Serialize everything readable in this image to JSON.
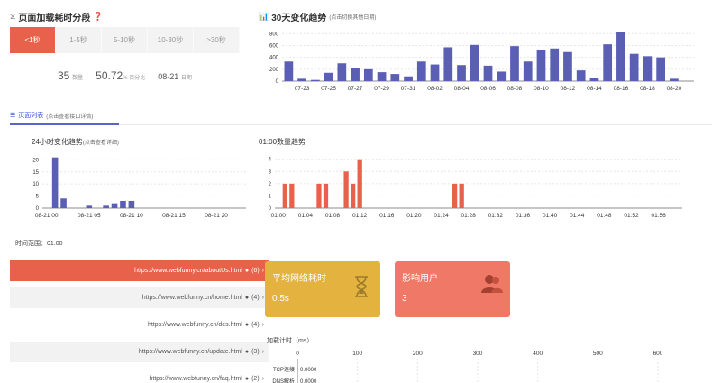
{
  "segment_panel": {
    "title": "页面加载耗时分段",
    "tabs": [
      "<1秒",
      "1-5秒",
      "5-10秒",
      "10-30秒",
      ">30秒"
    ],
    "active_index": 0,
    "stats": {
      "count": "35",
      "count_unit": "数量",
      "percent": "50.72",
      "percent_unit": "% 百分比",
      "date": "08-21",
      "date_unit": "日期"
    }
  },
  "trend30": {
    "title": "30天变化趋势",
    "hint": "(点击切换其他日期)"
  },
  "page_list": {
    "tab_label": "页面列表",
    "tab_hint": "(点击查看接口详情)"
  },
  "hourly": {
    "title": "24小时变化趋势",
    "hint": "(点击查看详细)"
  },
  "minute": {
    "title": "01:00数量趋势"
  },
  "time_range": "时间范围：01:00",
  "urls": [
    {
      "url": "https://www.webfunny.cn/aboutUs.html",
      "count": "(6)"
    },
    {
      "url": "https://www.webfunny.cn/home.html",
      "count": "(4)"
    },
    {
      "url": "https://www.webfunny.cn/des.html",
      "count": "(4)"
    },
    {
      "url": "https://www.webfunny.cn/update.html",
      "count": "(3)"
    },
    {
      "url": "https://www.webfunny.cn/faq.html",
      "count": "(2)"
    }
  ],
  "cards": {
    "network": {
      "title": "平均网络耗时",
      "value": "0.5s",
      "color": "#e3b23f"
    },
    "users": {
      "title": "影响用户",
      "value": "3",
      "color": "#f07866"
    }
  },
  "timing": {
    "title": "加载计时",
    "unit": "（ms）",
    "rows": [
      {
        "label": "TCP连接",
        "value": "0.0000"
      },
      {
        "label": "DNS解析",
        "value": "0.0000"
      }
    ]
  },
  "colors": {
    "accent": "#e8614a",
    "bar_blue": "#5b5fb4",
    "bar_red": "#e8614a"
  },
  "chart_data": [
    {
      "type": "bar",
      "title": "30天变化趋势",
      "x": [
        "07-22",
        "07-23",
        "07-24",
        "07-25",
        "07-26",
        "07-27",
        "07-28",
        "07-29",
        "07-30",
        "07-31",
        "08-01",
        "08-02",
        "08-03",
        "08-04",
        "08-05",
        "08-06",
        "08-07",
        "08-08",
        "08-09",
        "08-10",
        "08-11",
        "08-12",
        "08-13",
        "08-14",
        "08-15",
        "08-16",
        "08-17",
        "08-18",
        "08-19",
        "08-20",
        "08-21"
      ],
      "values": [
        330,
        40,
        20,
        140,
        300,
        220,
        200,
        150,
        120,
        80,
        330,
        280,
        570,
        270,
        610,
        260,
        160,
        590,
        330,
        520,
        550,
        490,
        180,
        60,
        620,
        820,
        460,
        420,
        400,
        40,
        0
      ],
      "xticks": [
        "07-23",
        "07-25",
        "07-27",
        "07-29",
        "07-31",
        "08-02",
        "08-04",
        "08-06",
        "08-08",
        "08-10",
        "08-12",
        "08-14",
        "08-16",
        "08-18",
        "08-20"
      ],
      "yticks": [
        0,
        200,
        400,
        600,
        800
      ],
      "ylim": [
        0,
        850
      ]
    },
    {
      "type": "bar",
      "title": "24小时变化趋势",
      "x": [
        0,
        1,
        2,
        3,
        4,
        5,
        6,
        7,
        8,
        9,
        10,
        11,
        12,
        13,
        14,
        15,
        16,
        17,
        18,
        19,
        20,
        21,
        22,
        23
      ],
      "values": [
        0,
        21,
        4,
        0,
        0,
        1,
        0,
        1,
        2,
        3,
        3,
        0,
        0,
        0,
        0,
        0,
        0,
        0,
        0,
        0,
        0,
        0,
        0,
        0
      ],
      "xticks": [
        "08-21 00",
        "08-21 05",
        "08-21 10",
        "08-21 15",
        "08-21 20"
      ],
      "yticks": [
        0,
        5,
        10,
        15,
        20
      ],
      "ylim": [
        0,
        22
      ]
    },
    {
      "type": "bar",
      "title": "01:00数量趋势",
      "x_labels": [
        "01:00",
        "01:04",
        "01:08",
        "01:12",
        "01:16",
        "01:20",
        "01:24",
        "01:28",
        "01:32",
        "01:36",
        "01:40",
        "01:44",
        "01:48",
        "01:52",
        "01:56"
      ],
      "points": [
        [
          1,
          2
        ],
        [
          2,
          2
        ],
        [
          6,
          2
        ],
        [
          7,
          2
        ],
        [
          10,
          3
        ],
        [
          11,
          2
        ],
        [
          12,
          4
        ],
        [
          26,
          2
        ],
        [
          27,
          2
        ]
      ],
      "yticks": [
        0,
        1,
        2,
        3,
        4
      ],
      "ylim": [
        0,
        4.2
      ]
    },
    {
      "type": "bar",
      "title": "加载计时",
      "categories": [
        "TCP连接",
        "DNS解析"
      ],
      "values": [
        0,
        0
      ],
      "xticks": [
        0,
        100,
        200,
        300,
        400,
        500,
        600
      ],
      "xlim": [
        0,
        600
      ]
    }
  ]
}
